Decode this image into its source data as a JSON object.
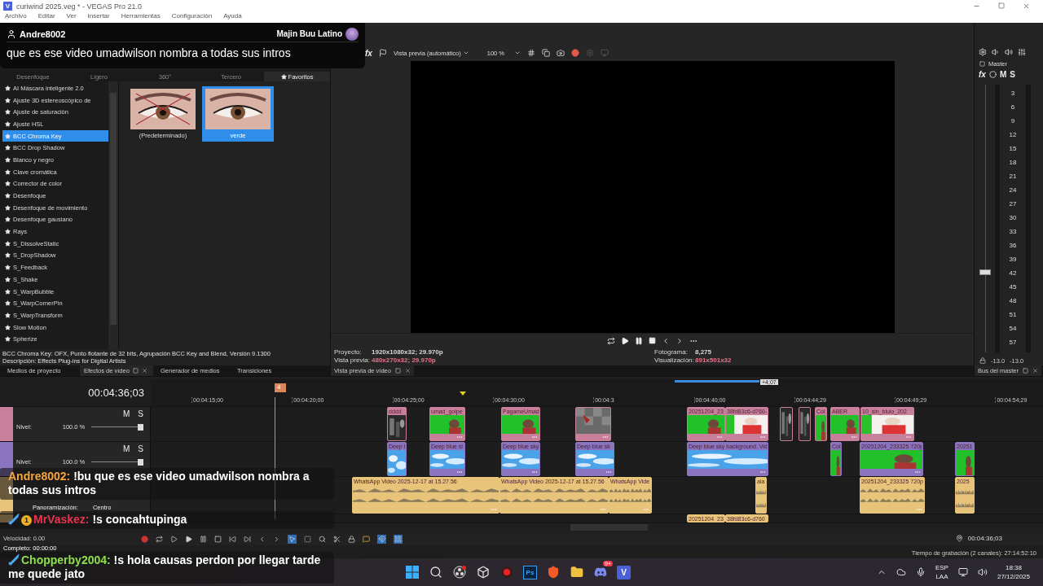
{
  "window": {
    "app_icon": "V",
    "title": "curiwind 2025.veg * - VEGAS Pro 21.0"
  },
  "menu": [
    "Archivo",
    "Editar",
    "Ver",
    "Insertar",
    "Herramientas",
    "Configuración",
    "Ayuda"
  ],
  "stream_overlay": {
    "user": "Andre8002",
    "channel": "Majin Buu Latino",
    "message": "que es ese video umadwilson nombra a todas sus intros"
  },
  "effects_panel": {
    "tabs": [
      {
        "label": "Desenfoque",
        "selected": false,
        "kind": "category"
      },
      {
        "label": "Ligero",
        "selected": false,
        "kind": "category"
      },
      {
        "label": "360°",
        "selected": false,
        "kind": "category"
      },
      {
        "label": "Tercero",
        "selected": false,
        "kind": "category"
      },
      {
        "label": "Favoritos",
        "selected": true,
        "kind": "favorites"
      }
    ],
    "effects": [
      {
        "label": "AI Máscara inteligente 2.0",
        "selected": false
      },
      {
        "label": "Ajuste 3D estereoscópico de",
        "selected": false
      },
      {
        "label": "Ajuste de saturación",
        "selected": false
      },
      {
        "label": "Ajuste HSL",
        "selected": false
      },
      {
        "label": "BCC Chroma Key",
        "selected": true
      },
      {
        "label": "BCC Drop Shadow",
        "selected": false
      },
      {
        "label": "Blanco y negro",
        "selected": false
      },
      {
        "label": "Clave cromática",
        "selected": false
      },
      {
        "label": "Corrector de color",
        "selected": false
      },
      {
        "label": "Desenfoque",
        "selected": false
      },
      {
        "label": "Desenfoque de movimiento",
        "selected": false
      },
      {
        "label": "Desenfoque gausiano",
        "selected": false
      },
      {
        "label": "Rays",
        "selected": false
      },
      {
        "label": "S_DissolveStatic",
        "selected": false
      },
      {
        "label": "S_DropShadow",
        "selected": false
      },
      {
        "label": "S_Feedback",
        "selected": false
      },
      {
        "label": "S_Shake",
        "selected": false
      },
      {
        "label": "S_WarpBubble",
        "selected": false
      },
      {
        "label": "S_WarpCornerPin",
        "selected": false
      },
      {
        "label": "S_WarpTransform",
        "selected": false
      },
      {
        "label": "Slow Motion",
        "selected": false
      },
      {
        "label": "Spherize",
        "selected": false
      }
    ],
    "presets": [
      {
        "label": "(Predeterminado)",
        "selected": false,
        "crossed": true
      },
      {
        "label": "verde",
        "selected": true,
        "crossed": false
      }
    ],
    "description": [
      "BCC Chroma Key: OFX, Punto flotante de 32 bits, Agrupación BCC Key and Blend, Versión 9.1300",
      "Descripción: Effects Plug-ins for Digital Artists"
    ]
  },
  "dock_tabs": [
    {
      "label": "Medios de proyecto",
      "selected": false
    },
    {
      "label": "Efectos de vídeo",
      "selected": true
    },
    {
      "label": "Generador de medios",
      "selected": false
    },
    {
      "label": "Transiciones",
      "selected": false
    }
  ],
  "preview": {
    "fx": "fx",
    "mode": "Vista previa (automático)",
    "zoom": "100 %",
    "info": [
      {
        "label": "Proyecto:",
        "value": "1920x1080x32; 29.970p",
        "color": "#d8d8d8"
      },
      {
        "label": "Vista previa:",
        "value": "480x270x32; 29.970p",
        "color": "#e8738a"
      },
      {
        "label": "Fotograma:",
        "value": "8,275",
        "color": "#d8d8d8"
      },
      {
        "label": "Visualización:",
        "value": "891x501x32",
        "color": "#e8738a"
      }
    ],
    "tab": "Vista previa de vídeo"
  },
  "master": {
    "title": "Master",
    "fx": "fx",
    "mute": "M",
    "solo": "S",
    "scale": [
      "3",
      "6",
      "9",
      "12",
      "15",
      "18",
      "21",
      "24",
      "27",
      "30",
      "33",
      "36",
      "39",
      "42",
      "45",
      "48",
      "51",
      "54",
      "57"
    ],
    "level": 0.29,
    "readings": [
      "-13.0",
      "-13.0"
    ],
    "tab": "Bus del master"
  },
  "timeline": {
    "time": "00:04:36;03",
    "marker": "4",
    "loop_length": "+4;07",
    "ruler": [
      "00:04:15;00",
      "00:04:20;00",
      "00:04:25;00",
      "00:04:30;00",
      "00:04:3",
      "00:04:40;00",
      "00:04:44;29",
      "00:04:49;29",
      "00:04:54;29"
    ],
    "tracks": [
      {
        "kind": "video",
        "color": "#c77f9c",
        "mute": "M",
        "solo": "S",
        "level_label": "Nivel:",
        "level_text": "100.0 %",
        "level": 1,
        "clips": [
          {
            "label": "dddd",
            "kind": "dark"
          },
          {
            "label": "umad_golpe",
            "kind": "green"
          },
          {
            "label": "PagameUmad",
            "kind": "green"
          },
          {
            "kind": "checker"
          },
          {
            "label": "20251204_23",
            "kind": "green"
          },
          {
            "label": "38fd83c6-d760-",
            "kind": "white"
          },
          {
            "kind": "dark"
          },
          {
            "kind": "dark"
          },
          {
            "label": "Col",
            "kind": "green"
          },
          {
            "label": "ABER",
            "kind": "green"
          },
          {
            "label": "10_sin_blulo_202",
            "kind": "white"
          }
        ]
      },
      {
        "kind": "video",
        "color": "#8a74c0",
        "mute": "M",
        "solo": "S",
        "level_label": "Nivel:",
        "level_text": "100.0 %",
        "level": 1,
        "clips": [
          {
            "label": "Deep I",
            "kind": "sky"
          },
          {
            "label": "Deep blue sl",
            "kind": "sky"
          },
          {
            "label": "Deep blue sky",
            "kind": "sky"
          },
          {
            "label": "Deep blue sk",
            "kind": "sky"
          },
          {
            "label": "Deep blue sky background. Vid",
            "kind": "sky"
          },
          {
            "label": "Col",
            "kind": "green"
          },
          {
            "label": "20251204_233325 720p",
            "kind": "green"
          },
          {
            "label": "20251",
            "kind": "green"
          }
        ]
      },
      {
        "kind": "audio",
        "color": "#e8c47a",
        "pan_label": "Panoramización:",
        "pan": "Centro",
        "clips": [
          {
            "label": "WhatsApp Video 2025-12-17 at 15.27.56"
          },
          {
            "label": "WhatsApp Video 2025-12-17 at 15.27.56"
          },
          {
            "label": "WhatsApp Vide"
          },
          {
            "label": "ala"
          },
          {
            "label": "20251204_233325 720p"
          },
          {
            "label": "2025"
          }
        ]
      },
      {
        "kind": "audio",
        "color": "#e8c47a",
        "clips": [
          {
            "label": "20251204_23"
          },
          {
            "label": "38fd83c6-d760"
          }
        ]
      }
    ],
    "speed": "Velocidad: 0.00",
    "cursor_time": "00:04:36;03"
  },
  "status": {
    "complete": "Completo: 00:00:00",
    "record_time": "Tiempo de grabación (2 canales): 27:14:52:10"
  },
  "chat": [
    {
      "user": "Andre8002:",
      "color": "#f5a63a",
      "text": "!bu que es ese video umadwilson nombra a todas sus intros",
      "sword": false
    },
    {
      "user": "MrVaskez:",
      "color": "#e8334f",
      "text": "!s concahtupinga",
      "sword": true,
      "badge": "1"
    },
    {
      "user": "Chopperby2004:",
      "color": "#8ee04a",
      "text": "!s hola causas perdon por llegar tarde me quede jato",
      "sword": true
    }
  ],
  "taskbar": {
    "apps": [
      {
        "kind": "start"
      },
      {
        "kind": "search"
      },
      {
        "kind": "obs"
      },
      {
        "kind": "cube"
      },
      {
        "kind": "record"
      },
      {
        "kind": "ps",
        "text": "Ps"
      },
      {
        "kind": "brave"
      },
      {
        "kind": "folder"
      },
      {
        "kind": "discord",
        "badge": "9+"
      },
      {
        "kind": "vegas",
        "text": "V"
      }
    ],
    "lang": [
      "ESP",
      "LAA"
    ],
    "time": "18:38",
    "date": "27/12/2025"
  }
}
